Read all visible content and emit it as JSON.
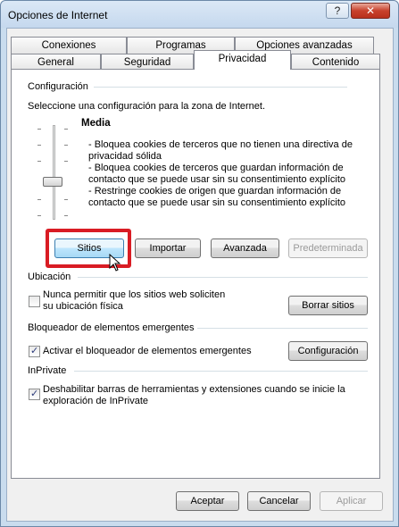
{
  "window": {
    "title": "Opciones de Internet",
    "help_label": "?",
    "close_label": "✕"
  },
  "tabs_row1": [
    "Conexiones",
    "Programas",
    "Opciones avanzadas"
  ],
  "tabs_row2": [
    "General",
    "Seguridad",
    "Privacidad",
    "Contenido"
  ],
  "active_tab": "Privacidad",
  "config": {
    "group": "Configuración",
    "instruction": "Seleccione una configuración para la zona de Internet.",
    "level": "Media",
    "desc": [
      "- Bloquea cookies de terceros que no tienen una directiva de",
      "privacidad sólida",
      "- Bloquea cookies de terceros que guardan información de",
      "contacto que se puede usar sin su consentimiento explícito",
      "- Restringe cookies de origen que guardan información de",
      "contacto que se puede usar sin su consentimiento explícito"
    ],
    "buttons": {
      "sites": "Sitios",
      "import": "Importar",
      "advanced": "Avanzada",
      "default": "Predeterminada"
    }
  },
  "location": {
    "group": "Ubicación",
    "checkbox_line1": "Nunca permitir que los sitios web soliciten",
    "checkbox_line2": "su ubicación física",
    "checked": false,
    "clear_button": "Borrar sitios"
  },
  "popup": {
    "group": "Bloqueador de elementos emergentes",
    "checkbox": "Activar el bloqueador de elementos emergentes",
    "checked": true,
    "config_button": "Configuración"
  },
  "inprivate": {
    "group": "InPrivate",
    "checkbox_line1": "Deshabilitar barras de herramientas y extensiones cuando se inicie la",
    "checkbox_line2": "exploración de InPrivate",
    "checked": true
  },
  "footer": {
    "ok": "Aceptar",
    "cancel": "Cancelar",
    "apply": "Aplicar"
  }
}
